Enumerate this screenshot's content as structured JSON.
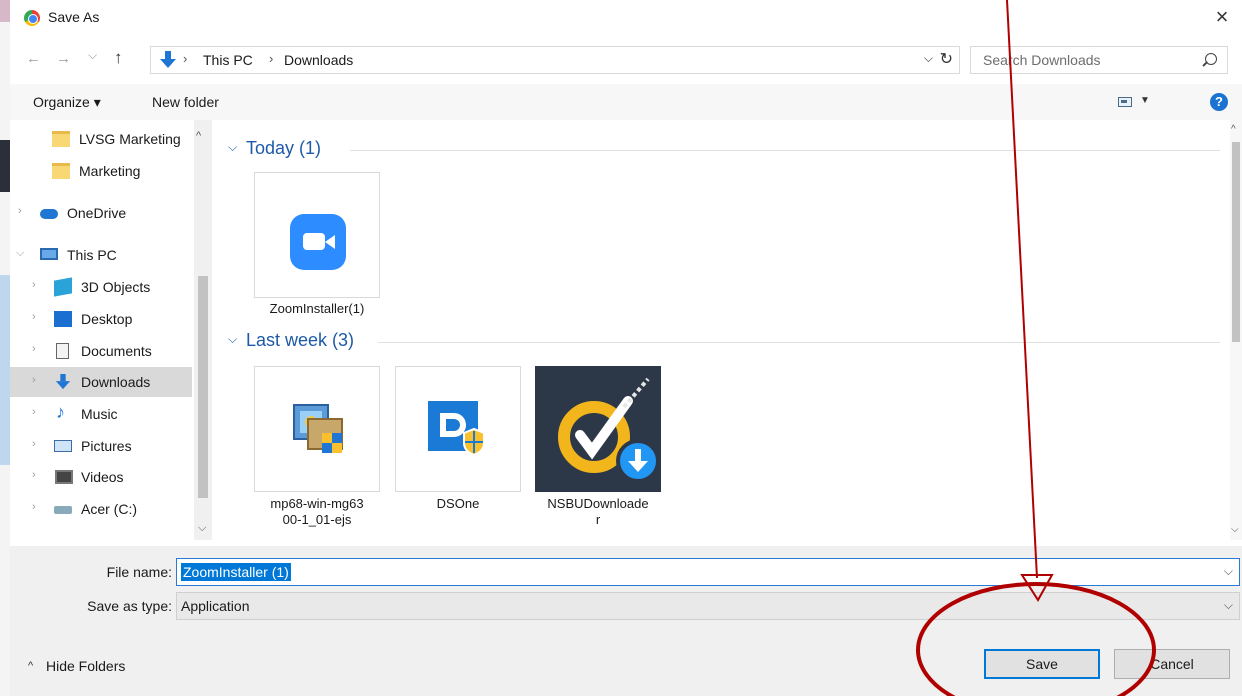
{
  "window": {
    "title": "Save As",
    "close_glyph": "×"
  },
  "nav": {
    "back_glyph": "←",
    "forward_glyph": "→",
    "recent_glyph": "⌵",
    "up_glyph": "↑",
    "breadcrumbs": [
      "This PC",
      "Downloads"
    ],
    "breadcrumb_sep": "›",
    "dropdown_glyph": "⌵",
    "refresh_glyph": "↻",
    "search_placeholder": "Search Downloads"
  },
  "toolbar": {
    "organize_label": "Organize ▾",
    "new_folder_label": "New folder",
    "help_glyph": "?",
    "view_dd_glyph": "▼"
  },
  "tree": [
    {
      "label": "LVSG Marketing",
      "icon": "folder-icon",
      "chevron": "",
      "selected": false
    },
    {
      "label": "Marketing",
      "icon": "folder-icon",
      "chevron": "",
      "selected": false
    },
    {
      "label": "OneDrive",
      "icon": "onedrive-icon",
      "chevron": "›",
      "selected": false
    },
    {
      "label": "This PC",
      "icon": "pc-icon",
      "chevron": "⌵",
      "selected": false
    },
    {
      "label": "3D Objects",
      "icon": "3d-objects-icon",
      "chevron": "›",
      "selected": false
    },
    {
      "label": "Desktop",
      "icon": "desktop-icon",
      "chevron": "›",
      "selected": false
    },
    {
      "label": "Documents",
      "icon": "documents-icon",
      "chevron": "›",
      "selected": false
    },
    {
      "label": "Downloads",
      "icon": "downloads-icon",
      "chevron": "›",
      "selected": true
    },
    {
      "label": "Music",
      "icon": "music-icon",
      "chevron": "›",
      "selected": false
    },
    {
      "label": "Pictures",
      "icon": "pictures-icon",
      "chevron": "›",
      "selected": false
    },
    {
      "label": "Videos",
      "icon": "videos-icon",
      "chevron": "›",
      "selected": false
    },
    {
      "label": "Acer (C:)",
      "icon": "drive-icon",
      "chevron": "›",
      "selected": false
    }
  ],
  "groups": [
    {
      "label": "Today (1)",
      "chevron": "⌵"
    },
    {
      "label": "Last week (3)",
      "chevron": "⌵"
    }
  ],
  "files": [
    {
      "name": "ZoomInstaller(1)",
      "icon": "zoom-app-icon"
    },
    {
      "name": "mp68-win-mg6300-1_01-ejs",
      "line1": "mp68-win-mg63",
      "line2": "00-1_01-ejs",
      "icon": "installer-package-icon"
    },
    {
      "name": "DSOne",
      "icon": "dsone-app-icon"
    },
    {
      "name": "NSBUDownloader",
      "line1": "NSBUDownloade",
      "line2": "r",
      "icon": "nsbu-downloader-icon"
    }
  ],
  "form": {
    "file_name_label": "File name:",
    "file_name_value": "ZoomInstaller (1)",
    "save_as_type_label": "Save as type:",
    "save_as_type_value": "Application",
    "chevron": "⌵"
  },
  "footer": {
    "hide_folders_label": "Hide Folders",
    "hide_folders_chevron": "^",
    "save_label": "Save",
    "cancel_label": "Cancel"
  },
  "scroll": {
    "up_glyph": "^",
    "down_glyph": "⌵"
  },
  "colors": {
    "accent": "#0078d7",
    "group_header": "#1e5aa8",
    "annotation_red": "#b00000",
    "zoom_blue": "#2d8cff"
  }
}
